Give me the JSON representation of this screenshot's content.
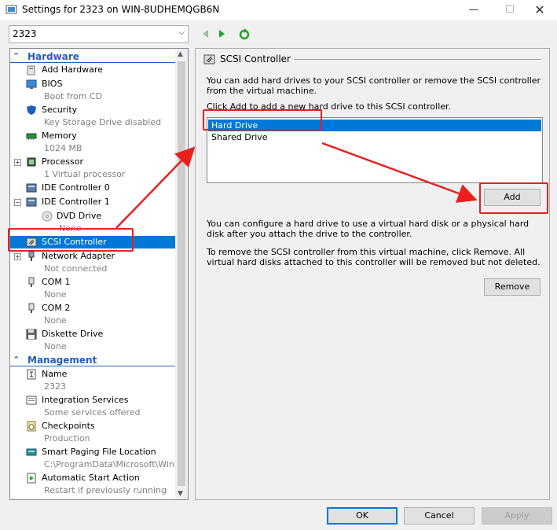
{
  "window": {
    "title": "Settings for 2323 on WIN-8UDHEMQGB6N",
    "min_glyph": "—",
    "max_glyph": "☐",
    "close_glyph": "✕"
  },
  "vm_selector": {
    "value": "2323",
    "chevron": "⌵"
  },
  "tree": {
    "hardware_header": "Hardware",
    "management_header": "Management",
    "collapse_glyph": "⌃",
    "items": [
      {
        "label": "Add Hardware",
        "sub": "",
        "icon": "add-hardware-icon"
      },
      {
        "label": "BIOS",
        "sub": "Boot from CD",
        "icon": "bios-icon"
      },
      {
        "label": "Security",
        "sub": "Key Storage Drive disabled",
        "icon": "shield-icon"
      },
      {
        "label": "Memory",
        "sub": "1024 MB",
        "icon": "memory-icon"
      },
      {
        "label": "Processor",
        "sub": "1 Virtual processor",
        "icon": "processor-icon"
      },
      {
        "label": "IDE Controller 0",
        "sub": "",
        "icon": "ide-controller-icon"
      },
      {
        "label": "IDE Controller 1",
        "sub": "",
        "icon": "ide-controller-icon"
      },
      {
        "label": "DVD Drive",
        "sub": "None",
        "icon": "dvd-drive-icon"
      },
      {
        "label": "SCSI Controller",
        "sub": "",
        "icon": "scsi-controller-icon"
      },
      {
        "label": "Network Adapter",
        "sub": "Not connected",
        "icon": "network-adapter-icon"
      },
      {
        "label": "COM 1",
        "sub": "None",
        "icon": "com-port-icon"
      },
      {
        "label": "COM 2",
        "sub": "None",
        "icon": "com-port-icon"
      },
      {
        "label": "Diskette Drive",
        "sub": "None",
        "icon": "diskette-icon"
      },
      {
        "label": "Name",
        "sub": "2323",
        "icon": "name-icon"
      },
      {
        "label": "Integration Services",
        "sub": "Some services offered",
        "icon": "integration-services-icon"
      },
      {
        "label": "Checkpoints",
        "sub": "Production",
        "icon": "checkpoints-icon"
      },
      {
        "label": "Smart Paging File Location",
        "sub": "C:\\ProgramData\\Microsoft\\Win...",
        "icon": "smart-paging-icon"
      },
      {
        "label": "Automatic Start Action",
        "sub": "Restart if previously running",
        "icon": "auto-start-icon"
      }
    ]
  },
  "panel": {
    "title": "SCSI Controller",
    "intro": "You can add hard drives to your SCSI controller or remove the SCSI controller from the virtual machine.",
    "click_add": "Click Add to add a new hard drive to this SCSI controller.",
    "drive_options": [
      "Hard Drive",
      "Shared Drive"
    ],
    "selected_option": "Hard Drive",
    "add_label": "Add",
    "configure_text": "You can configure a hard drive to use a virtual hard disk or a physical hard disk after you attach the drive to the controller.",
    "remove_text": "To remove the SCSI controller from this virtual machine, click Remove. All virtual hard disks attached to this controller will be removed but not deleted.",
    "remove_label": "Remove"
  },
  "footer": {
    "ok_label": "OK",
    "cancel_label": "Cancel",
    "apply_label": "Apply"
  },
  "colors": {
    "accent": "#0078d7",
    "section": "#1f5fbf",
    "annotation": "#e8201e"
  }
}
